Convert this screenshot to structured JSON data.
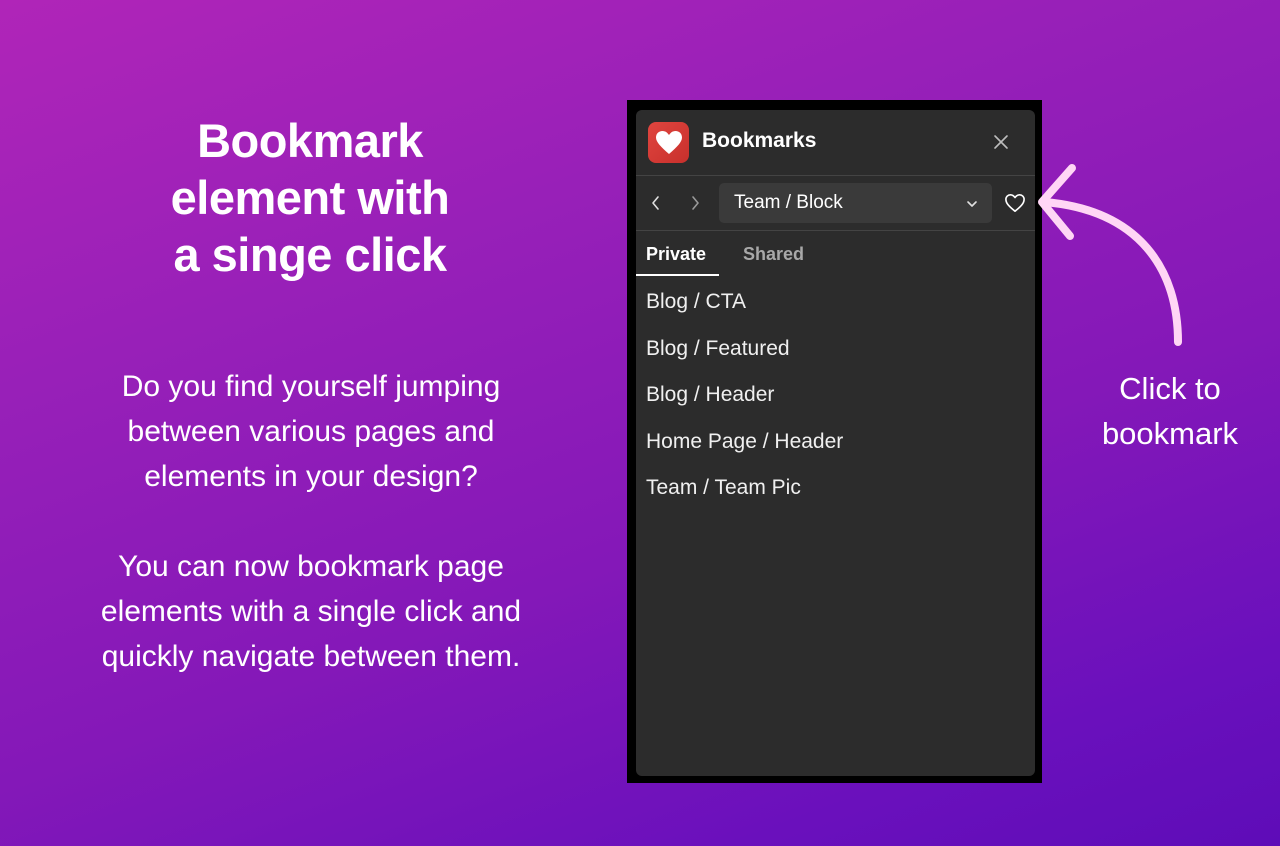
{
  "promo": {
    "headline": [
      "Bookmark",
      "element with",
      "a singe click"
    ],
    "paragraph1": [
      "Do you find yourself jumping",
      "between various pages and",
      "elements in your design?"
    ],
    "paragraph2": [
      "You can now bookmark page",
      "elements with a single click and",
      "quickly navigate between them."
    ]
  },
  "panel": {
    "title": "Bookmarks",
    "logo_icon": "heart-logo-icon",
    "close_icon": "close-icon",
    "nav": {
      "back_icon": "chevron-left-icon",
      "forward_icon": "chevron-right-icon",
      "selected_element": "Team / Block",
      "dropdown_icon": "chevron-down-icon",
      "bookmark_icon": "heart-outline-icon"
    },
    "tabs": [
      {
        "label": "Private",
        "active": true
      },
      {
        "label": "Shared",
        "active": false
      }
    ],
    "bookmarks": [
      "Blog / CTA",
      "Blog / Featured",
      "Blog / Header",
      "Home Page / Header",
      "Team / Team Pic"
    ]
  },
  "callout": {
    "label": [
      "Click to",
      "bookmark"
    ],
    "arrow_color": "#ffd6f5"
  },
  "colors": {
    "background_start": "#b025b8",
    "background_end": "#5e0cb8",
    "panel_bg": "#2c2c2c",
    "logo_red": "#d83a35"
  }
}
